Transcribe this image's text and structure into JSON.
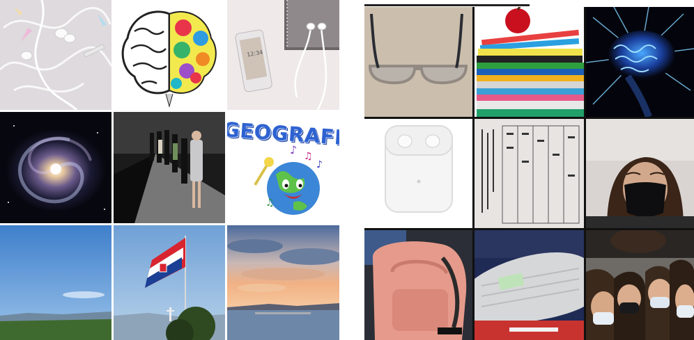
{
  "left_collage": {
    "tiles": [
      {
        "subject": "earphones"
      },
      {
        "subject": "brain-doodle"
      },
      {
        "subject": "phone-earphones-notebook"
      },
      {
        "subject": "galaxy"
      },
      {
        "subject": "fashion-runway"
      },
      {
        "subject": "geography",
        "text": "GEOGRAFIJA"
      },
      {
        "subject": "sky-hills"
      },
      {
        "subject": "croatian-flag"
      },
      {
        "subject": "sunset-sea"
      }
    ]
  },
  "right_collage": {
    "tiles": [
      {
        "subject": "glasses"
      },
      {
        "subject": "books-apple"
      },
      {
        "subject": "glowing-brain"
      },
      {
        "subject": "airpods"
      },
      {
        "subject": "tables-paper"
      },
      {
        "subject": "selfie-mask"
      },
      {
        "subject": "pink-backpack"
      },
      {
        "subject": "pencil-case"
      },
      {
        "subject": "group-selfie"
      }
    ]
  },
  "colors": {
    "background": "#ffffff",
    "sky": "#4f89cf",
    "galaxy": "#0d0d1c",
    "brain_glow": "#2a7cff",
    "backpack": "#e59a8b"
  }
}
